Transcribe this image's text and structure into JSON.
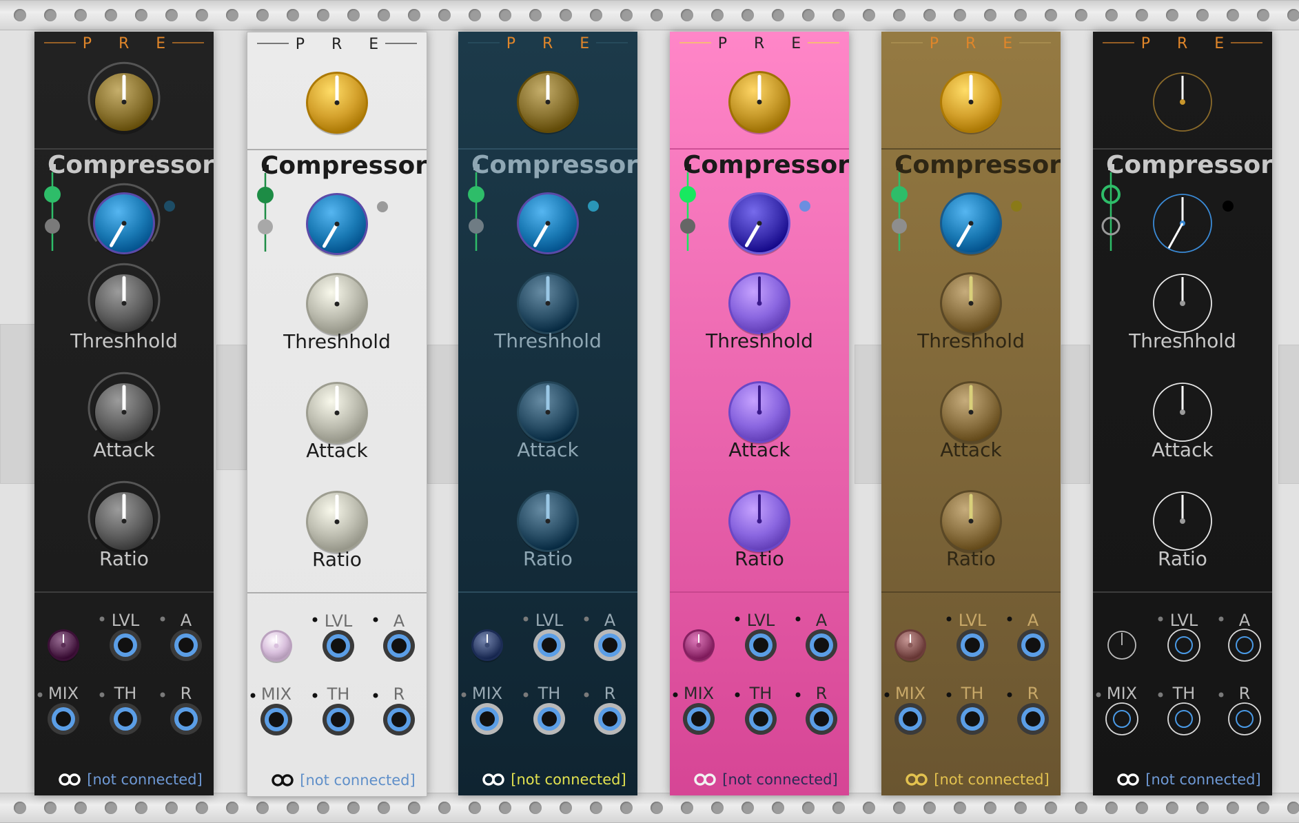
{
  "module": {
    "header": "P R E",
    "section_title": "Compressor",
    "knob_labels": {
      "threshold": "Threshhold",
      "attack": "Attack",
      "ratio": "Ratio"
    },
    "jack_labels": {
      "lvl": "LVL",
      "a": "A",
      "mix": "MIX",
      "th": "TH",
      "r": "R"
    },
    "footer_status": "[not connected]",
    "footer_icon": "infinity-link-icon"
  },
  "panels": [
    {
      "theme": "dark",
      "bg_top": "#222222",
      "bg_bottom": "#1a1a1a",
      "header_color": "#e0862a",
      "header_line": "#e0862a",
      "title_color": "#c8c8c8",
      "label_color": "#c8c8c8",
      "divider": "#4a4a4a",
      "gain_knob": "#8a7330",
      "comp_knob": "#1a7ab5",
      "comp_ring": "#5b4aa8",
      "param_knob": "#606060",
      "indicator_light": "#1d4d66",
      "jack_label": "#bcbcbc",
      "mix_knob": "#5a2e55",
      "status_color": "#6f9ad6",
      "switch_top": "#2ebd69",
      "switch_bottom": "#7a7a7a",
      "style": "filled"
    },
    {
      "theme": "light",
      "bg_top": "#ebebeb",
      "bg_bottom": "#e6e6e6",
      "header_color": "#222222",
      "header_line": "#333333",
      "title_color": "#1a1a1a",
      "label_color": "#1a1a1a",
      "divider": "#9a9a9a",
      "gain_knob": "#d4a12c",
      "comp_knob": "#1a7ab5",
      "comp_ring": "#5b4aa8",
      "param_knob": "#bdbdb0",
      "indicator_light": "#9a9a9a",
      "jack_label": "#6e6e6e",
      "mix_knob": "#d9c0dd",
      "status_color": "#5f8fc9",
      "switch_top": "#1d8c45",
      "switch_bottom": "#a8a8a8",
      "style": "filled"
    },
    {
      "theme": "navy",
      "bg_top": "#1c3a4a",
      "bg_bottom": "#0f2431",
      "header_color": "#e0862a",
      "header_line": "#2d5466",
      "title_color": "#8fa7b4",
      "label_color": "#8fa7b4",
      "divider": "#35596b",
      "gain_knob": "#8a7330",
      "comp_knob": "#1a7ab5",
      "comp_ring": "#5b4aa8",
      "param_knob": "#2b5068",
      "indicator_light": "#2a96b8",
      "jack_label": "#98a9b3",
      "mix_knob": "#3a4a73",
      "status_color": "#e3e24f",
      "switch_top": "#2ebd69",
      "switch_bottom": "#6f7c84",
      "style": "filled"
    },
    {
      "theme": "pink",
      "bg_top": "#ff86c8",
      "bg_bottom": "#d64595",
      "header_color": "#222222",
      "header_line": "#f6d84a",
      "title_color": "#1a1a1a",
      "label_color": "#1a1a1a",
      "divider": "#c04088",
      "gain_knob": "#c79a2a",
      "comp_knob": "#3b2fb0",
      "comp_ring": "#6d5bd6",
      "param_knob": "#8a66e0",
      "indicator_light": "#6c8ee0",
      "jack_label": "#2a2a2a",
      "mix_knob": "#a33e7f",
      "status_color": "#2a2a55",
      "switch_top": "#18e860",
      "switch_bottom": "#666666",
      "style": "filled"
    },
    {
      "theme": "gold",
      "bg_top": "#957a42",
      "bg_bottom": "#6a5530",
      "header_color": "#e0862a",
      "header_line": "#b09656",
      "title_color": "#2e2614",
      "label_color": "#2e2614",
      "divider": "#4d3e22",
      "gain_knob": "#d4a12c",
      "comp_knob": "#1a7ab5",
      "comp_ring": "#1a5a8a",
      "param_knob": "#8a7040",
      "indicator_light": "#8a7a18",
      "jack_label": "#c8a868",
      "mix_knob": "#8a5a58",
      "status_color": "#e3c24f",
      "switch_top": "#2ebd69",
      "switch_bottom": "#8e8e8e",
      "style": "filled"
    },
    {
      "theme": "outline",
      "bg_top": "#1a1a1a",
      "bg_bottom": "#151515",
      "header_color": "#e0862a",
      "header_line": "#e0862a",
      "title_color": "#c8c8c8",
      "label_color": "#c8c8c8",
      "divider": "#4a4a4a",
      "gain_knob": "#8a6a2a",
      "comp_knob": "#3a8ad6",
      "comp_ring": "#3a8ad6",
      "param_knob": "#e8e8e8",
      "indicator_light": "#000000",
      "jack_label": "#bcbcbc",
      "mix_knob": "#9a9a9a",
      "status_color": "#6f9ad6",
      "switch_top": "#2ebd69",
      "switch_bottom": "#9a9a9a",
      "style": "outline"
    }
  ]
}
